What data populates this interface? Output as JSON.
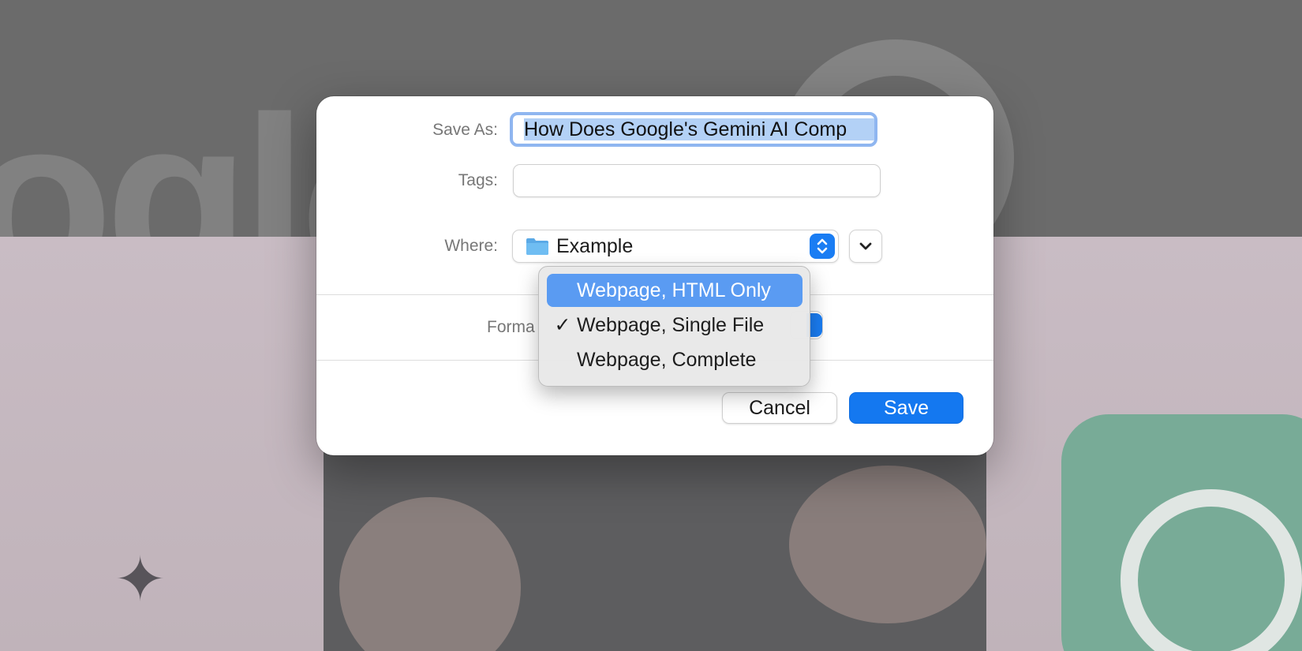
{
  "dialog": {
    "save_as_label": "Save As:",
    "save_as_value": "How Does Google's Gemini AI Comp",
    "tags_label": "Tags:",
    "tags_value": "",
    "where_label": "Where:",
    "where_value": "Example",
    "format_label": "Forma",
    "cancel_label": "Cancel",
    "save_label": "Save"
  },
  "format_menu": {
    "items": [
      {
        "label": "Webpage, HTML Only",
        "checked": "",
        "highlighted": true
      },
      {
        "label": "Webpage, Single File",
        "checked": "✓",
        "highlighted": false
      },
      {
        "label": "Webpage, Complete",
        "checked": "",
        "highlighted": false
      }
    ]
  },
  "icons": {
    "folder": "folder-icon",
    "where_stepper": "up-down-chevron-icon",
    "expand": "chevron-down-icon",
    "checkmark": "checkmark-icon"
  },
  "colors": {
    "accent": "#1478f0",
    "menu_highlight": "#5a9bf2",
    "focus_ring": "#8fb6f0",
    "selection": "#b3d1f6"
  }
}
